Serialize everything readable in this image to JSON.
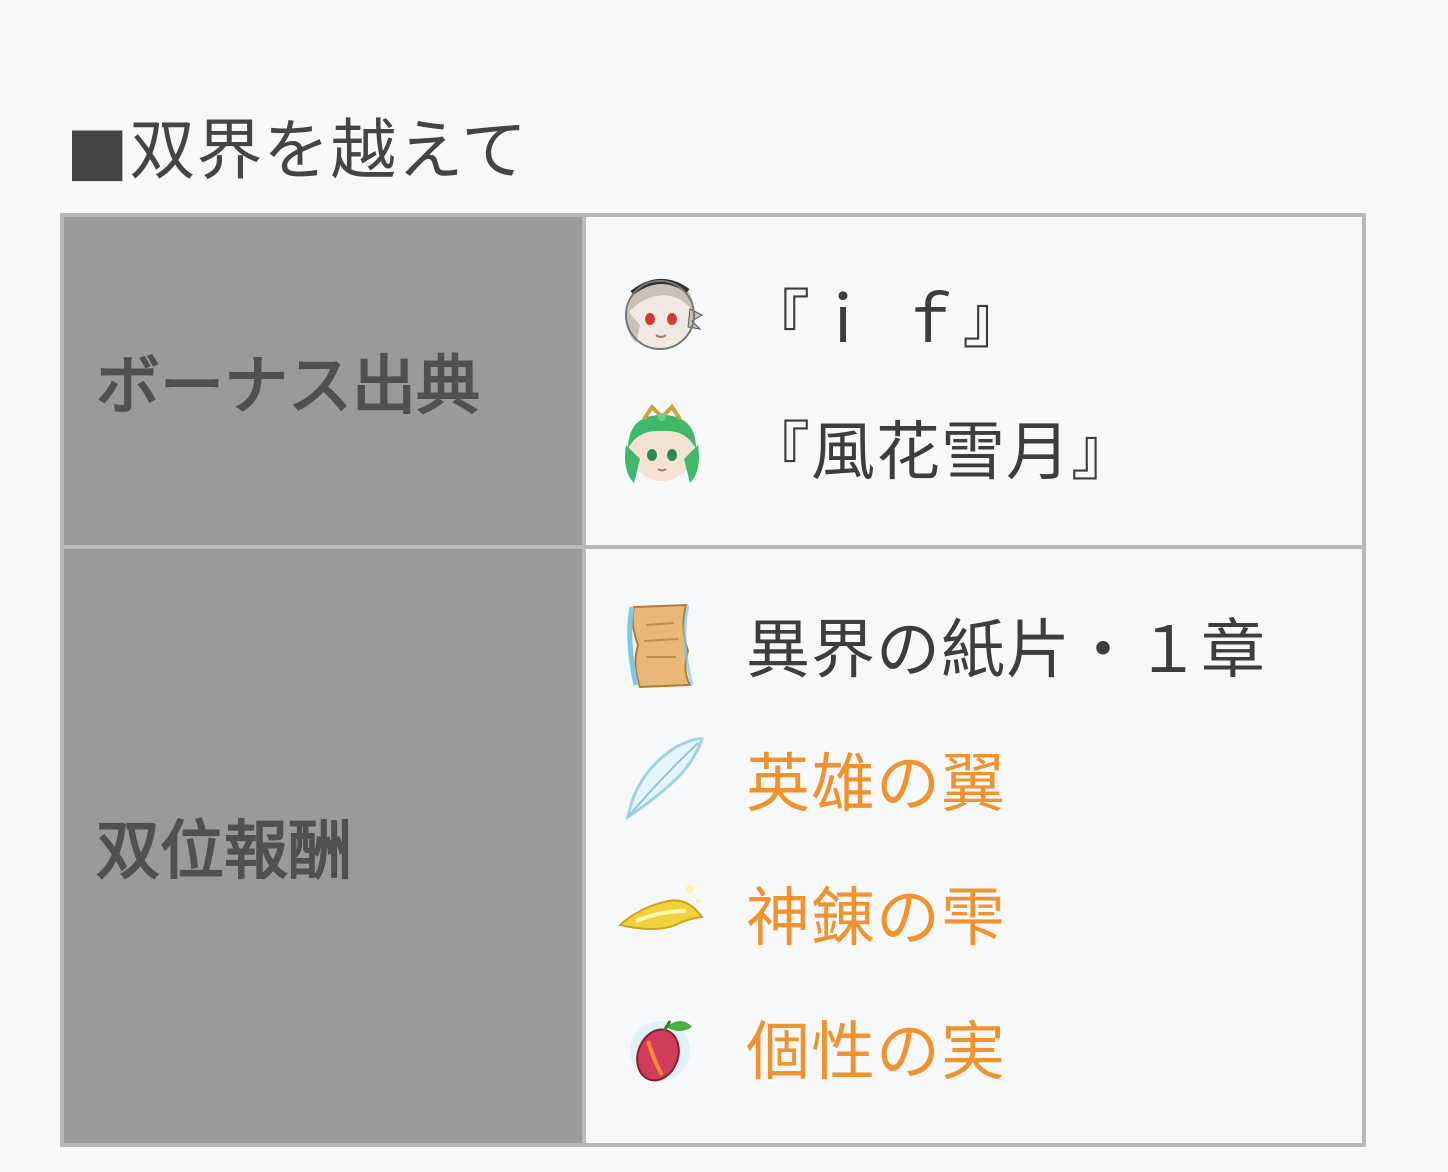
{
  "section": {
    "title": "■双界を越えて"
  },
  "table": {
    "bonus_header": "ボーナス出典",
    "bonus_entries": [
      {
        "icon": "heroine-portrait-icon",
        "label": "『ｉ ｆ』"
      },
      {
        "icon": "green-hair-heroine-portrait-icon",
        "label": "『風花雪月』"
      }
    ],
    "reward_header": "双位報酬",
    "reward_entries": [
      {
        "icon": "parchment-scroll-icon",
        "label": "異界の紙片・１章",
        "is_link": false
      },
      {
        "icon": "feather-icon",
        "label": "英雄の翼",
        "is_link": true
      },
      {
        "icon": "golden-drop-icon",
        "label": "神錬の雫",
        "is_link": true
      },
      {
        "icon": "fruit-icon",
        "label": "個性の実",
        "is_link": true
      }
    ]
  },
  "colors": {
    "header_bg": "#9a9a9a",
    "link": "#f0922e",
    "border": "#b9b9b9"
  }
}
